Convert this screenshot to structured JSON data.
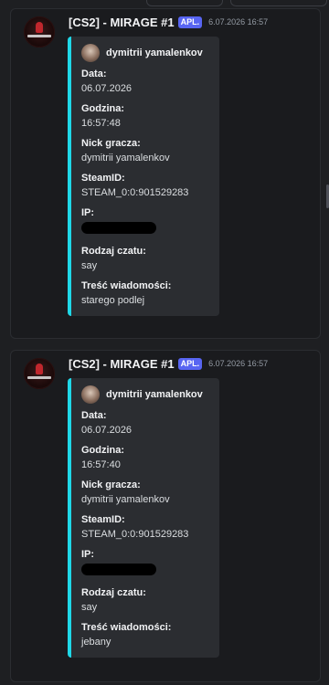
{
  "messages": [
    {
      "username": "[CS2] - MIRAGE #1",
      "app_badge": "APL.",
      "timestamp": "6.07.2026 16:57",
      "embed": {
        "author": "dymitrii yamalenkov",
        "fields": [
          {
            "name": "Data:",
            "value": "06.07.2026"
          },
          {
            "name": "Godzina:",
            "value": "16:57:48"
          },
          {
            "name": "Nick gracza:",
            "value": "dymitrii yamalenkov"
          },
          {
            "name": "SteamID:",
            "value": "STEAM_0:0:901529283"
          },
          {
            "name": "IP:",
            "value": ""
          },
          {
            "name": "Rodzaj czatu:",
            "value": "say"
          },
          {
            "name": "Treść wiadomości:",
            "value": "starego podlej"
          }
        ],
        "accent_color": "#1fd8e8"
      }
    },
    {
      "username": "[CS2] - MIRAGE #1",
      "app_badge": "APL.",
      "timestamp": "6.07.2026 16:57",
      "embed": {
        "author": "dymitrii yamalenkov",
        "fields": [
          {
            "name": "Data:",
            "value": "06.07.2026"
          },
          {
            "name": "Godzina:",
            "value": "16:57:40"
          },
          {
            "name": "Nick gracza:",
            "value": "dymitrii yamalenkov"
          },
          {
            "name": "SteamID:",
            "value": "STEAM_0:0:901529283"
          },
          {
            "name": "IP:",
            "value": ""
          },
          {
            "name": "Rodzaj czatu:",
            "value": "say"
          },
          {
            "name": "Treść wiadomości:",
            "value": "jebany"
          }
        ],
        "accent_color": "#1fd8e8"
      }
    }
  ],
  "colors": {
    "background": "#1e1f22",
    "embed_background": "#2b2d31",
    "badge": "#5865f2"
  }
}
